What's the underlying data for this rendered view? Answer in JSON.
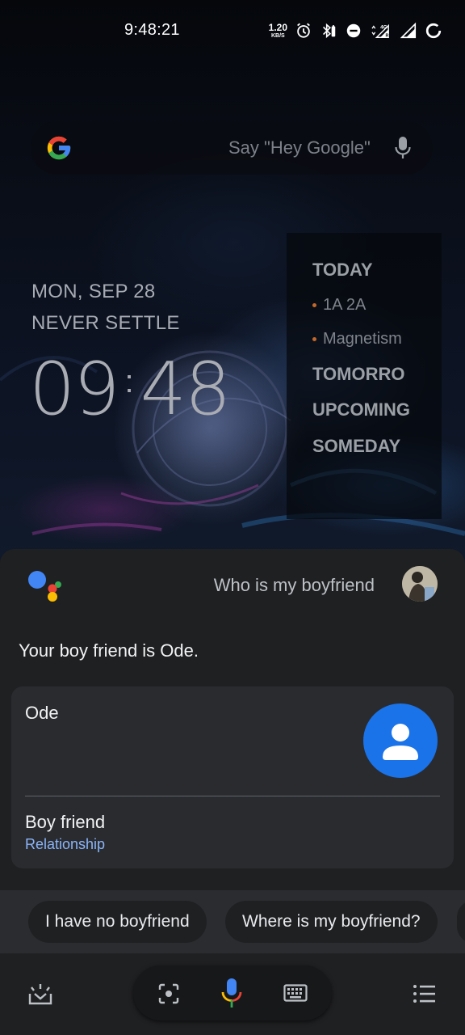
{
  "status_bar": {
    "time": "9:48:21",
    "net_speed_value": "1.20",
    "net_speed_unit": "KB/S",
    "icons": [
      "alarm-icon",
      "bluetooth-battery-icon",
      "do-not-disturb-icon",
      "data-arrows-icon",
      "signal-4g-r-icon",
      "signal-icon",
      "battery-ring-icon"
    ]
  },
  "search_widget": {
    "hint": "Say \"Hey Google\"",
    "icons": [
      "google-g-icon",
      "mic-icon"
    ]
  },
  "clock_widget": {
    "date": "MON, SEP 28",
    "motto": "NEVER SETTLE",
    "hours": "09",
    "minutes": "48"
  },
  "task_widget": {
    "today": "TODAY",
    "today_items": [
      "1A 2A",
      "Magnetism"
    ],
    "tomorrow": "TOMORRO",
    "upcoming": "UPCOMING",
    "someday": "SOMEDAY",
    "bullet_color": "#c4682a"
  },
  "assistant": {
    "query": "Who is my boyfriend",
    "answer": "Your boy friend is Ode.",
    "card": {
      "name": "Ode",
      "relation": "Boy friend",
      "relation_sub": "Relationship",
      "avatar_color": "#1a73e8"
    },
    "suggestions": [
      "I have no boyfriend",
      "Where is my boyfriend?"
    ],
    "toolbar_icons": [
      "explore-updates-icon",
      "lens-icon",
      "mic-icon",
      "keyboard-icon",
      "list-icon"
    ]
  },
  "colors": {
    "google_blue": "#4285f4",
    "google_red": "#ea4335",
    "google_yellow": "#fbbc04",
    "google_green": "#34a853",
    "sheet_bg": "#1f2022",
    "link_blue": "#8ab4f8"
  }
}
